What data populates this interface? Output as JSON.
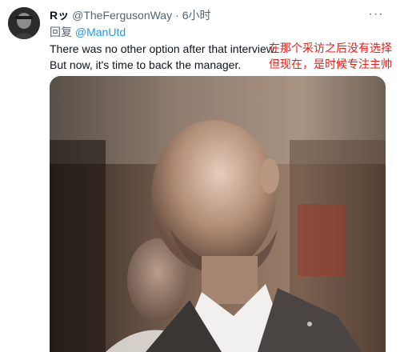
{
  "author": {
    "display_name": "Rッ",
    "handle": "@TheFergusonWay",
    "separator": "·",
    "time": "6小时"
  },
  "reply": {
    "prefix": "回复",
    "mention": "@ManUtd"
  },
  "tweet": {
    "lines": [
      "There was no other option after that interview.",
      "But now, it's time to back the manager."
    ]
  },
  "translation": {
    "lines": [
      "在那个采访之后没有选择",
      "但现在，是时候专注主帅"
    ]
  },
  "colors": {
    "text": "#0f1419",
    "secondary": "#536471",
    "link": "#1d9bf0",
    "translation": "#e0201a"
  },
  "icons": {
    "more": "more-horizontal-icon"
  },
  "media": {
    "description_icon": "photo"
  }
}
